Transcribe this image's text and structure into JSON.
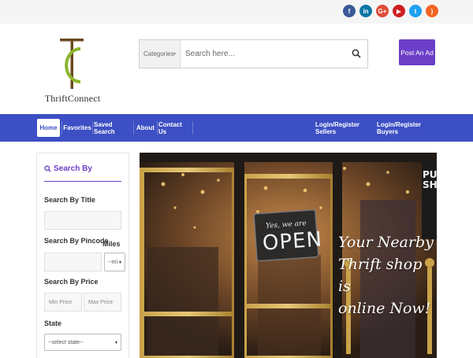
{
  "social": {
    "icons": [
      {
        "name": "facebook-icon",
        "glyph": "f",
        "color": "#3b5998"
      },
      {
        "name": "linkedin-icon",
        "glyph": "in",
        "color": "#0e76a8"
      },
      {
        "name": "google-plus-icon",
        "glyph": "G+",
        "color": "#dd4b39"
      },
      {
        "name": "youtube-icon",
        "glyph": "▶",
        "color": "#cd201f"
      },
      {
        "name": "twitter-icon",
        "glyph": "t",
        "color": "#1da1f2"
      },
      {
        "name": "rss-icon",
        "glyph": ")",
        "color": "#f26522"
      }
    ]
  },
  "brand": {
    "name": "ThriftConnect",
    "logo_gold": "#6b4a1f",
    "logo_green": "#8bb52d"
  },
  "search": {
    "categories_label": "Categories",
    "placeholder": "Search here...",
    "value": ""
  },
  "post_ad_label": "Post An Ad",
  "nav": {
    "items": [
      "Home",
      "Favorites",
      "Saved Search",
      "About",
      "Contact Us"
    ],
    "right_items": [
      "Login/Register Sellers",
      "Login/Register Buyers"
    ]
  },
  "sidebar": {
    "title": "Search By",
    "title_label": "Search By Title",
    "title_value": "",
    "pincode_label": "Search By Pincode",
    "pincode_value": "",
    "miles_label": "Miles",
    "miles_value": "--mi",
    "price_label": "Search By Price",
    "min_price_placeholder": "Min Price",
    "max_price_placeholder": "Max Price",
    "state_label": "State",
    "state_value": "--select state--"
  },
  "hero": {
    "lines": [
      "Your Nearby",
      "Thrift shop is",
      "online Now!"
    ],
    "sign_small": "Yes, we are",
    "sign_big": "OPEN",
    "side_sign": "PUSH"
  },
  "colors": {
    "accent": "#6b3fc7",
    "nav": "#3c4fc4"
  }
}
